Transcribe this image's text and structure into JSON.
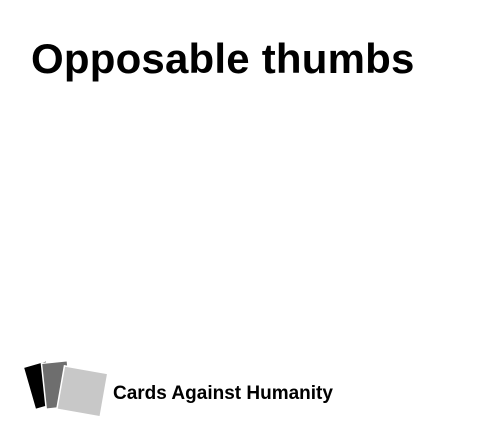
{
  "card": {
    "text": "Opposable thumbs",
    "text_color": "#000000",
    "background_color": "#ffffff"
  },
  "brand": {
    "name": "Cards Against Humanity",
    "logo_icon": "stacked-cards-icon",
    "logo_colors": [
      "#000000",
      "#6e6e6e",
      "#c8c8c8"
    ]
  }
}
